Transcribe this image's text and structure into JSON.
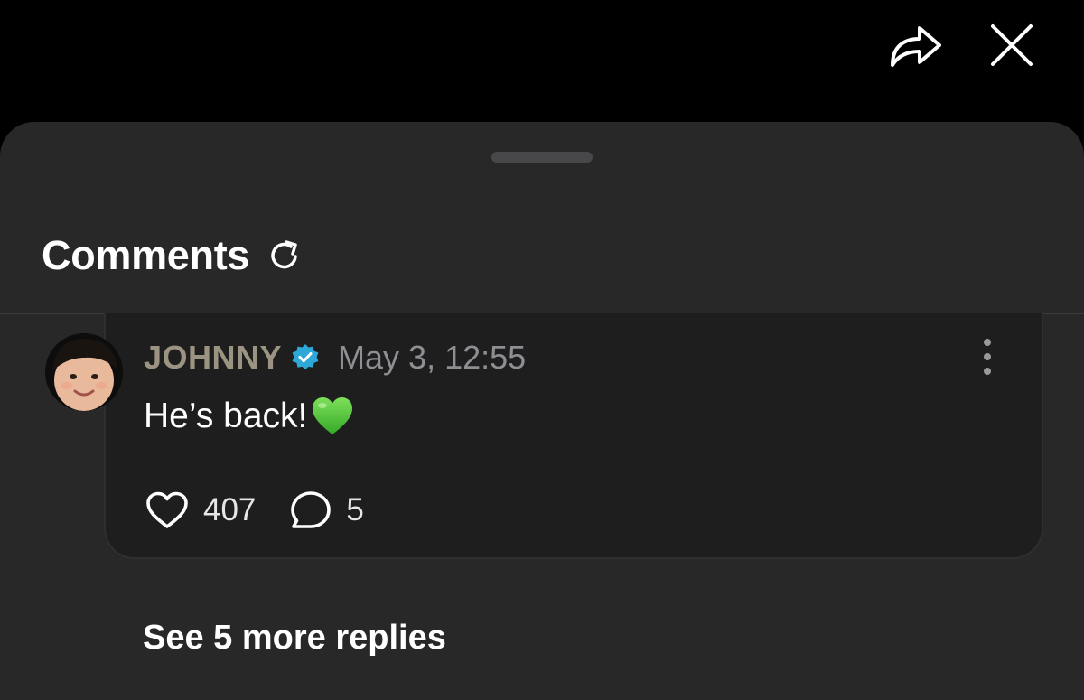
{
  "header": {
    "title": "Comments"
  },
  "comment": {
    "username": "JOHNNY",
    "timestamp": "May 3, 12:55",
    "text": "He’s back!",
    "likes": "407",
    "replies": "5"
  },
  "see_more_label": "See 5 more replies",
  "icons": {
    "share": "share-arrow-icon",
    "close": "close-icon",
    "refresh": "refresh-icon",
    "verified": "verified-badge-icon",
    "more": "more-vertical-icon",
    "emoji": "green-heart-emoji",
    "like": "heart-icon",
    "reply": "speech-bubble-icon"
  },
  "colors": {
    "background": "#000000",
    "sheet": "#282828",
    "card": "#1e1e1e",
    "username": "#9c9482",
    "verified": "#2ea8d8",
    "heart_emoji": "#4cc23a"
  }
}
